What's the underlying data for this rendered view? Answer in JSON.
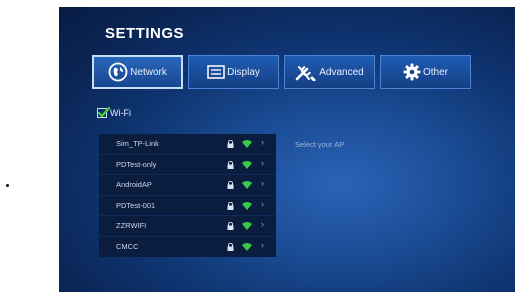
{
  "settings": {
    "title": "SETTINGS"
  },
  "tabs": [
    {
      "label": "Network",
      "icon": "globe-icon",
      "active": true
    },
    {
      "label": "Display",
      "icon": "display-icon",
      "active": false
    },
    {
      "label": "Advanced",
      "icon": "tools-icon",
      "active": false
    },
    {
      "label": "Other",
      "icon": "gear-icon",
      "active": false
    }
  ],
  "wifi": {
    "label": "Wi-Fi",
    "checked": true,
    "networks": [
      {
        "ssid": "Sim_TP-Link",
        "secured": true
      },
      {
        "ssid": "PDTest-only",
        "secured": true
      },
      {
        "ssid": "AndroidAP",
        "secured": true
      },
      {
        "ssid": "PDTest-001",
        "secured": true
      },
      {
        "ssid": "ZZRWIFI",
        "secured": true
      },
      {
        "ssid": "CMCC",
        "secured": true
      }
    ],
    "prompt": "Select your AP"
  },
  "colors": {
    "signal": "#38c94a",
    "accent": "#2a67ba",
    "check": "#4ccf3a"
  }
}
